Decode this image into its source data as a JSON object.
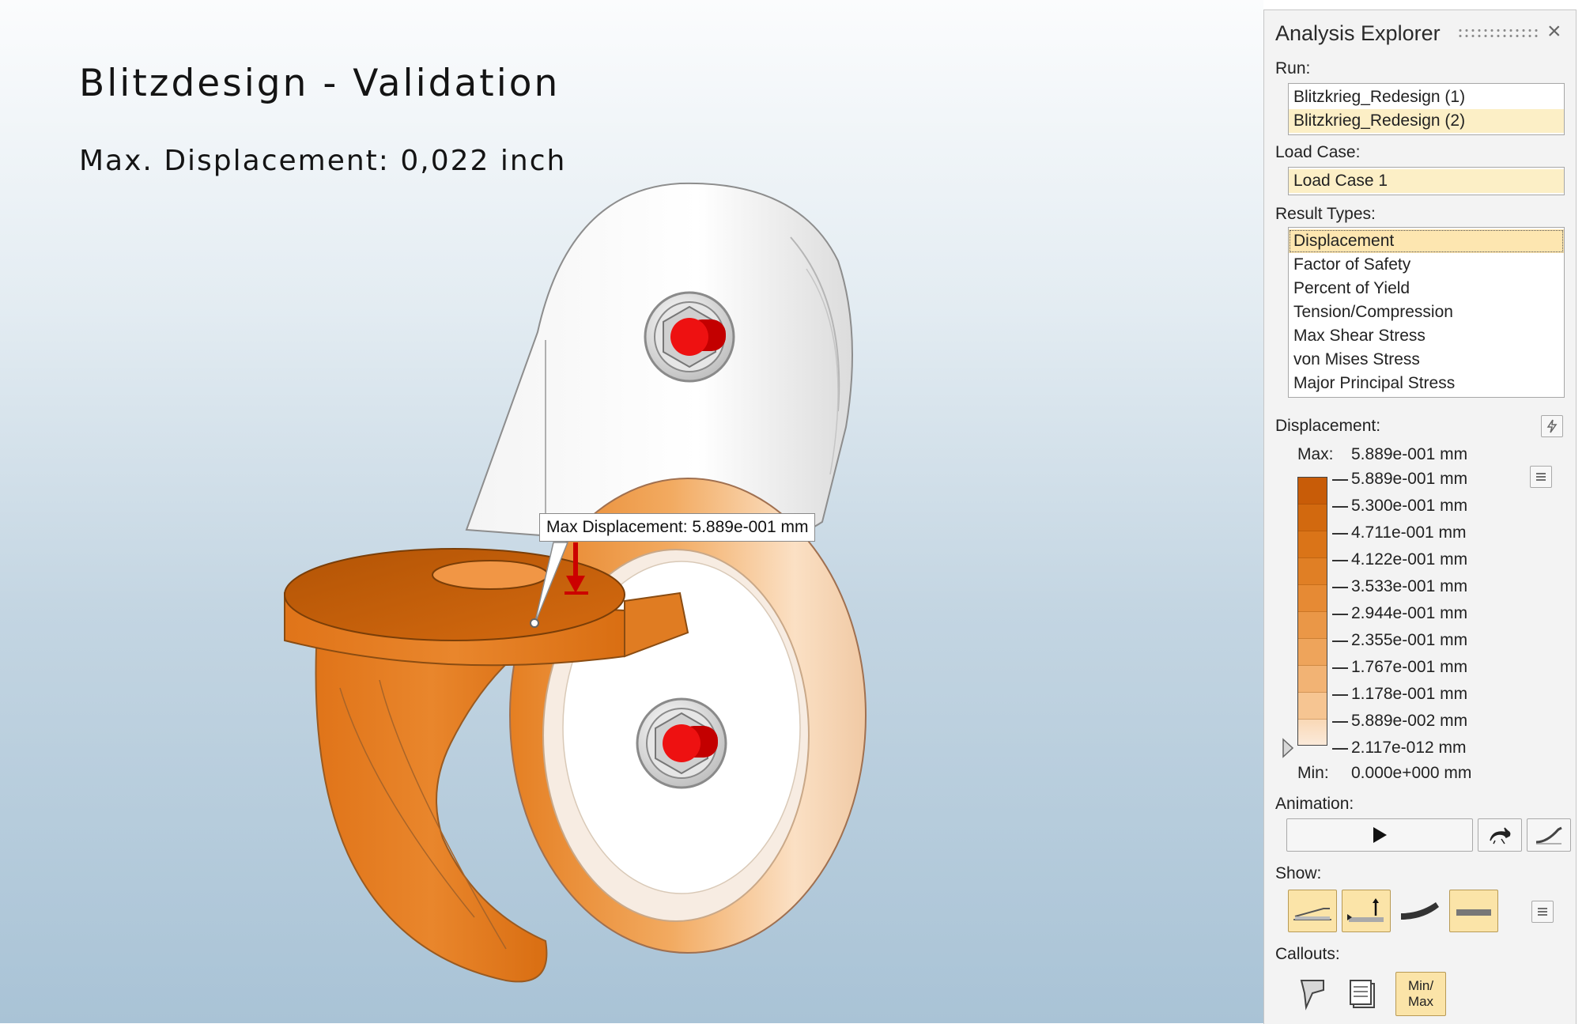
{
  "viewport": {
    "title": "Blitzdesign - Validation",
    "subtitle": "Max. Displacement: 0,022 inch",
    "callout": "Max Displacement: 5.889e-001 mm"
  },
  "panel": {
    "title": "Analysis Explorer",
    "run_label": "Run:",
    "runs": [
      "Blitzkrieg_Redesign (1)",
      "Blitzkrieg_Redesign (2)"
    ],
    "load_case_label": "Load Case:",
    "load_cases": [
      "Load Case 1"
    ],
    "result_types_label": "Result Types:",
    "result_types": [
      "Displacement",
      "Factor of Safety",
      "Percent of Yield",
      "Tension/Compression",
      "Max Shear Stress",
      "von Mises Stress",
      "Major Principal Stress"
    ],
    "legend_label": "Displacement:",
    "max_label": "Max:",
    "max_value": "5.889e-001 mm",
    "min_label": "Min:",
    "min_value": "0.000e+000 mm",
    "legend_values": [
      "5.889e-001 mm",
      "5.300e-001 mm",
      "4.711e-001 mm",
      "4.122e-001 mm",
      "3.533e-001 mm",
      "2.944e-001 mm",
      "2.355e-001 mm",
      "1.767e-001 mm",
      "1.178e-001 mm",
      "5.889e-002 mm",
      "2.117e-012 mm"
    ],
    "legend_colors": [
      "#c85c08",
      "#d2690f",
      "#da7418",
      "#e07f25",
      "#e68a34",
      "#ea9747",
      "#eea45b",
      "#f2b374",
      "#f6c592",
      "#f9d8b6",
      "#fbebdc"
    ],
    "animation_label": "Animation:",
    "show_label": "Show:",
    "callouts_label": "Callouts:",
    "minmax_button": "Min/ Max"
  }
}
